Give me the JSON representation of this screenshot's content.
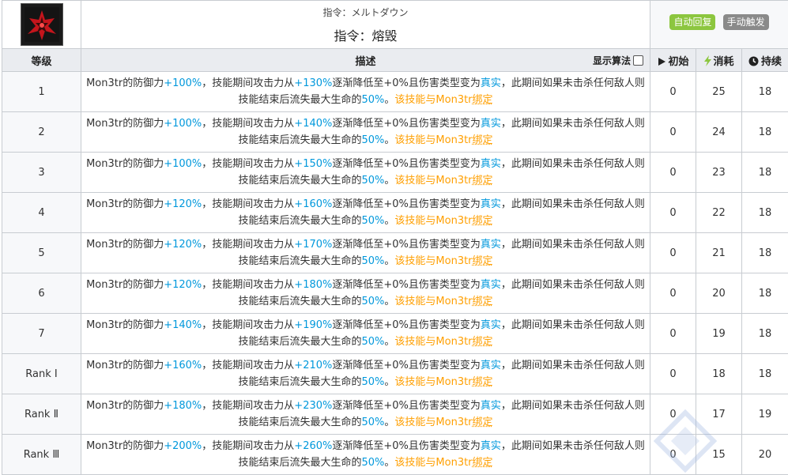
{
  "skill": {
    "icon": "meltdown-skill-icon",
    "name_jp": "指令：メルトダウン",
    "name_cn": "指令：熔毁",
    "tags": [
      {
        "label": "自动回复",
        "color": "#8cc63f"
      },
      {
        "label": "手动触发",
        "color": "#8a8a8a"
      }
    ]
  },
  "columns": {
    "level": "等级",
    "desc": "描述",
    "toggle": "显示算法",
    "initial": "初始",
    "cost": "消耗",
    "duration": "持续"
  },
  "text": {
    "p1": "Mon3tr的防御力",
    "p2": "，技能期间攻击力从",
    "p3": "逐渐降低至+0%且伤害类型变为",
    "true_dmg": "真实",
    "p4": "，此期间如果未击杀任何敌人则技能结束后流失最大生命的",
    "loss": "50%",
    "p5": "。",
    "note": "该技能与Mon3tr",
    "bind": "绑定"
  },
  "rows": [
    {
      "level": "1",
      "def": "+100%",
      "atk": "+130%",
      "initial": "0",
      "cost": "25",
      "duration": "18"
    },
    {
      "level": "2",
      "def": "+100%",
      "atk": "+140%",
      "initial": "0",
      "cost": "24",
      "duration": "18"
    },
    {
      "level": "3",
      "def": "+100%",
      "atk": "+150%",
      "initial": "0",
      "cost": "23",
      "duration": "18"
    },
    {
      "level": "4",
      "def": "+120%",
      "atk": "+160%",
      "initial": "0",
      "cost": "22",
      "duration": "18"
    },
    {
      "level": "5",
      "def": "+120%",
      "atk": "+170%",
      "initial": "0",
      "cost": "21",
      "duration": "18"
    },
    {
      "level": "6",
      "def": "+120%",
      "atk": "+180%",
      "initial": "0",
      "cost": "20",
      "duration": "18"
    },
    {
      "level": "7",
      "def": "+140%",
      "atk": "+190%",
      "initial": "0",
      "cost": "19",
      "duration": "18"
    },
    {
      "level": "Rank Ⅰ",
      "def": "+160%",
      "atk": "+210%",
      "initial": "0",
      "cost": "18",
      "duration": "18"
    },
    {
      "level": "Rank Ⅱ",
      "def": "+180%",
      "atk": "+230%",
      "initial": "0",
      "cost": "17",
      "duration": "19"
    },
    {
      "level": "Rank Ⅲ",
      "def": "+200%",
      "atk": "+260%",
      "initial": "0",
      "cost": "15",
      "duration": "20"
    }
  ]
}
